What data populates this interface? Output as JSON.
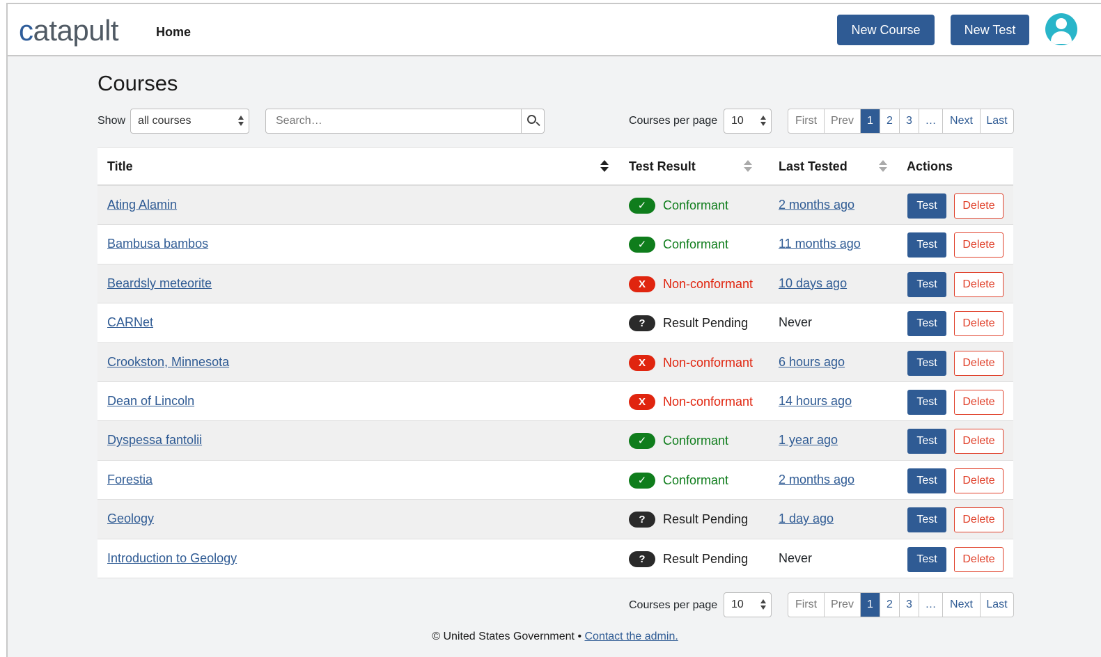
{
  "app": {
    "logo_text": "catapult",
    "nav_home": "Home",
    "new_course_label": "New Course",
    "new_test_label": "New Test"
  },
  "page": {
    "title": "Courses",
    "show_label": "Show",
    "show_selected": "all courses",
    "search_placeholder": "Search…",
    "per_page_label": "Courses per page",
    "per_page_value": "10"
  },
  "pagination": {
    "first": "First",
    "prev": "Prev",
    "pages": [
      "1",
      "2",
      "3"
    ],
    "ellipsis": "…",
    "next": "Next",
    "last": "Last",
    "current_page": "1"
  },
  "table": {
    "headers": {
      "title": "Title",
      "test_result": "Test Result",
      "last_tested": "Last Tested",
      "actions": "Actions"
    },
    "test_label": "Test",
    "delete_label": "Delete",
    "rows": [
      {
        "title": "Ating Alamin",
        "status": "conformant",
        "result": "Conformant",
        "last_tested": "2 months ago"
      },
      {
        "title": "Bambusa bambos",
        "status": "conformant",
        "result": "Conformant",
        "last_tested": "11 months ago"
      },
      {
        "title": "Beardsly meteorite",
        "status": "nonconformant",
        "result": "Non-conformant",
        "last_tested": "10 days ago"
      },
      {
        "title": "CARNet",
        "status": "pending",
        "result": "Result Pending",
        "last_tested": "Never"
      },
      {
        "title": "Crookston, Minnesota",
        "status": "nonconformant",
        "result": "Non-conformant",
        "last_tested": "6 hours ago"
      },
      {
        "title": "Dean of Lincoln",
        "status": "nonconformant",
        "result": "Non-conformant",
        "last_tested": "14 hours ago"
      },
      {
        "title": "Dyspessa fantolii",
        "status": "conformant",
        "result": "Conformant",
        "last_tested": "1 year ago"
      },
      {
        "title": "Forestia",
        "status": "conformant",
        "result": "Conformant",
        "last_tested": "2 months ago"
      },
      {
        "title": "Geology",
        "status": "pending",
        "result": "Result Pending",
        "last_tested": "1 day ago"
      },
      {
        "title": "Introduction to Geology",
        "status": "pending",
        "result": "Result Pending",
        "last_tested": "Never"
      }
    ]
  },
  "status_styles": {
    "conformant": {
      "symbol": "✓",
      "pill_color": "#0f7d1c",
      "text_color": "#0f7d1c"
    },
    "nonconformant": {
      "symbol": "X",
      "pill_color": "#e0250f",
      "text_color": "#e0250f"
    },
    "pending": {
      "symbol": "?",
      "pill_color": "#2a2a2a",
      "text_color": "#1b1b1b"
    }
  },
  "footer": {
    "text": "© United States Government • ",
    "link": "Contact the admin."
  },
  "colors": {
    "brand": "#2f5b94",
    "avatar": "#29b5c9",
    "delete": "#e0402a"
  }
}
